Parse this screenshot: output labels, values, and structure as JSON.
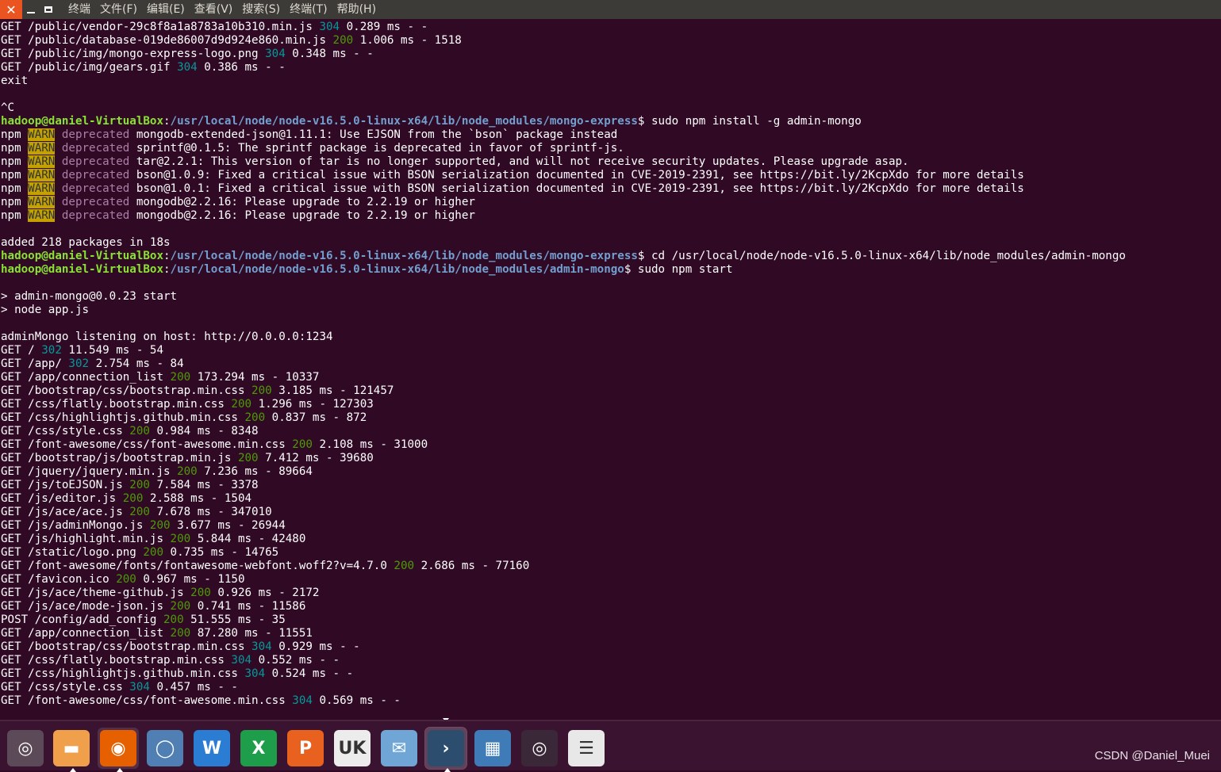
{
  "window": {
    "menus": [
      "终端",
      "文件(F)",
      "编辑(E)",
      "查看(V)",
      "搜索(S)",
      "终端(T)",
      "帮助(H)"
    ]
  },
  "terminal_lines": [
    [
      {
        "t": "GET /public/vendor-29c8f8a1a8783a10b310.min.js "
      },
      {
        "t": "304",
        "c": "c-304"
      },
      {
        "t": " 0.289 ms - -"
      }
    ],
    [
      {
        "t": "GET /public/database-019de86007d9d924e860.min.js "
      },
      {
        "t": "200",
        "c": "c-200"
      },
      {
        "t": " 1.006 ms - 1518"
      }
    ],
    [
      {
        "t": "GET /public/img/mongo-express-logo.png "
      },
      {
        "t": "304",
        "c": "c-304"
      },
      {
        "t": " 0.348 ms - -"
      }
    ],
    [
      {
        "t": "GET /public/img/gears.gif "
      },
      {
        "t": "304",
        "c": "c-304"
      },
      {
        "t": " 0.386 ms - -"
      }
    ],
    [
      {
        "t": "exit"
      }
    ],
    [
      {
        "t": ""
      }
    ],
    [
      {
        "t": "^C"
      }
    ],
    [
      {
        "t": "hadoop@daniel-VirtualBox",
        "c": "prompt-user"
      },
      {
        "t": ":"
      },
      {
        "t": "/usr/local/node/node-v16.5.0-linux-x64/lib/node_modules/mongo-express",
        "c": "prompt-path"
      },
      {
        "t": "$ sudo npm install -g admin-mongo"
      }
    ],
    [
      {
        "t": "npm "
      },
      {
        "t": "WARN",
        "c": "warn"
      },
      {
        "t": " "
      },
      {
        "t": "deprecated",
        "c": "dep"
      },
      {
        "t": " mongodb-extended-json@1.11.1: Use EJSON from the `bson` package instead"
      }
    ],
    [
      {
        "t": "npm "
      },
      {
        "t": "WARN",
        "c": "warn"
      },
      {
        "t": " "
      },
      {
        "t": "deprecated",
        "c": "dep"
      },
      {
        "t": " sprintf@0.1.5: The sprintf package is deprecated in favor of sprintf-js."
      }
    ],
    [
      {
        "t": "npm "
      },
      {
        "t": "WARN",
        "c": "warn"
      },
      {
        "t": " "
      },
      {
        "t": "deprecated",
        "c": "dep"
      },
      {
        "t": " tar@2.2.1: This version of tar is no longer supported, and will not receive security updates. Please upgrade asap."
      }
    ],
    [
      {
        "t": "npm "
      },
      {
        "t": "WARN",
        "c": "warn"
      },
      {
        "t": " "
      },
      {
        "t": "deprecated",
        "c": "dep"
      },
      {
        "t": " bson@1.0.9: Fixed a critical issue with BSON serialization documented in CVE-2019-2391, see https://bit.ly/2KcpXdo for more details"
      }
    ],
    [
      {
        "t": "npm "
      },
      {
        "t": "WARN",
        "c": "warn"
      },
      {
        "t": " "
      },
      {
        "t": "deprecated",
        "c": "dep"
      },
      {
        "t": " bson@1.0.1: Fixed a critical issue with BSON serialization documented in CVE-2019-2391, see https://bit.ly/2KcpXdo for more details"
      }
    ],
    [
      {
        "t": "npm "
      },
      {
        "t": "WARN",
        "c": "warn"
      },
      {
        "t": " "
      },
      {
        "t": "deprecated",
        "c": "dep"
      },
      {
        "t": " mongodb@2.2.16: Please upgrade to 2.2.19 or higher"
      }
    ],
    [
      {
        "t": "npm "
      },
      {
        "t": "WARN",
        "c": "warn"
      },
      {
        "t": " "
      },
      {
        "t": "deprecated",
        "c": "dep"
      },
      {
        "t": " mongodb@2.2.16: Please upgrade to 2.2.19 or higher"
      }
    ],
    [
      {
        "t": ""
      }
    ],
    [
      {
        "t": "added 218 packages in 18s"
      }
    ],
    [
      {
        "t": "hadoop@daniel-VirtualBox",
        "c": "prompt-user"
      },
      {
        "t": ":"
      },
      {
        "t": "/usr/local/node/node-v16.5.0-linux-x64/lib/node_modules/mongo-express",
        "c": "prompt-path"
      },
      {
        "t": "$ cd /usr/local/node/node-v16.5.0-linux-x64/lib/node_modules/admin-mongo"
      }
    ],
    [
      {
        "t": "hadoop@daniel-VirtualBox",
        "c": "prompt-user"
      },
      {
        "t": ":"
      },
      {
        "t": "/usr/local/node/node-v16.5.0-linux-x64/lib/node_modules/admin-mongo",
        "c": "prompt-path"
      },
      {
        "t": "$ sudo npm start"
      }
    ],
    [
      {
        "t": ""
      }
    ],
    [
      {
        "t": "> admin-mongo@0.0.23 start"
      }
    ],
    [
      {
        "t": "> node app.js"
      }
    ],
    [
      {
        "t": ""
      }
    ],
    [
      {
        "t": "adminMongo listening on host: http://0.0.0.0:1234"
      }
    ],
    [
      {
        "t": "GET / "
      },
      {
        "t": "302",
        "c": "c-302"
      },
      {
        "t": " 11.549 ms - 54"
      }
    ],
    [
      {
        "t": "GET /app/ "
      },
      {
        "t": "302",
        "c": "c-302"
      },
      {
        "t": " 2.754 ms - 84"
      }
    ],
    [
      {
        "t": "GET /app/connection_list "
      },
      {
        "t": "200",
        "c": "c-200"
      },
      {
        "t": " 173.294 ms - 10337"
      }
    ],
    [
      {
        "t": "GET /bootstrap/css/bootstrap.min.css "
      },
      {
        "t": "200",
        "c": "c-200"
      },
      {
        "t": " 3.185 ms - 121457"
      }
    ],
    [
      {
        "t": "GET /css/flatly.bootstrap.min.css "
      },
      {
        "t": "200",
        "c": "c-200"
      },
      {
        "t": " 1.296 ms - 127303"
      }
    ],
    [
      {
        "t": "GET /css/highlightjs.github.min.css "
      },
      {
        "t": "200",
        "c": "c-200"
      },
      {
        "t": " 0.837 ms - 872"
      }
    ],
    [
      {
        "t": "GET /css/style.css "
      },
      {
        "t": "200",
        "c": "c-200"
      },
      {
        "t": " 0.984 ms - 8348"
      }
    ],
    [
      {
        "t": "GET /font-awesome/css/font-awesome.min.css "
      },
      {
        "t": "200",
        "c": "c-200"
      },
      {
        "t": " 2.108 ms - 31000"
      }
    ],
    [
      {
        "t": "GET /bootstrap/js/bootstrap.min.js "
      },
      {
        "t": "200",
        "c": "c-200"
      },
      {
        "t": " 7.412 ms - 39680"
      }
    ],
    [
      {
        "t": "GET /jquery/jquery.min.js "
      },
      {
        "t": "200",
        "c": "c-200"
      },
      {
        "t": " 7.236 ms - 89664"
      }
    ],
    [
      {
        "t": "GET /js/toEJSON.js "
      },
      {
        "t": "200",
        "c": "c-200"
      },
      {
        "t": " 7.584 ms - 3378"
      }
    ],
    [
      {
        "t": "GET /js/editor.js "
      },
      {
        "t": "200",
        "c": "c-200"
      },
      {
        "t": " 2.588 ms - 1504"
      }
    ],
    [
      {
        "t": "GET /js/ace/ace.js "
      },
      {
        "t": "200",
        "c": "c-200"
      },
      {
        "t": " 7.678 ms - 347010"
      }
    ],
    [
      {
        "t": "GET /js/adminMongo.js "
      },
      {
        "t": "200",
        "c": "c-200"
      },
      {
        "t": " 3.677 ms - 26944"
      }
    ],
    [
      {
        "t": "GET /js/highlight.min.js "
      },
      {
        "t": "200",
        "c": "c-200"
      },
      {
        "t": " 5.844 ms - 42480"
      }
    ],
    [
      {
        "t": "GET /static/logo.png "
      },
      {
        "t": "200",
        "c": "c-200"
      },
      {
        "t": " 0.735 ms - 14765"
      }
    ],
    [
      {
        "t": "GET /font-awesome/fonts/fontawesome-webfont.woff2?v=4.7.0 "
      },
      {
        "t": "200",
        "c": "c-200"
      },
      {
        "t": " 2.686 ms - 77160"
      }
    ],
    [
      {
        "t": "GET /favicon.ico "
      },
      {
        "t": "200",
        "c": "c-200"
      },
      {
        "t": " 0.967 ms - 1150"
      }
    ],
    [
      {
        "t": "GET /js/ace/theme-github.js "
      },
      {
        "t": "200",
        "c": "c-200"
      },
      {
        "t": " 0.926 ms - 2172"
      }
    ],
    [
      {
        "t": "GET /js/ace/mode-json.js "
      },
      {
        "t": "200",
        "c": "c-200"
      },
      {
        "t": " 0.741 ms - 11586"
      }
    ],
    [
      {
        "t": "POST /config/add_config "
      },
      {
        "t": "200",
        "c": "c-200"
      },
      {
        "t": " 51.555 ms - 35"
      }
    ],
    [
      {
        "t": "GET /app/connection_list "
      },
      {
        "t": "200",
        "c": "c-200"
      },
      {
        "t": " 87.280 ms - 11551"
      }
    ],
    [
      {
        "t": "GET /bootstrap/css/bootstrap.min.css "
      },
      {
        "t": "304",
        "c": "c-304"
      },
      {
        "t": " 0.929 ms - -"
      }
    ],
    [
      {
        "t": "GET /css/flatly.bootstrap.min.css "
      },
      {
        "t": "304",
        "c": "c-304"
      },
      {
        "t": " 0.552 ms - -"
      }
    ],
    [
      {
        "t": "GET /css/highlightjs.github.min.css "
      },
      {
        "t": "304",
        "c": "c-304"
      },
      {
        "t": " 0.524 ms - -"
      }
    ],
    [
      {
        "t": "GET /css/style.css "
      },
      {
        "t": "304",
        "c": "c-304"
      },
      {
        "t": " 0.457 ms - -"
      }
    ],
    [
      {
        "t": "GET /font-awesome/css/font-awesome.min.css "
      },
      {
        "t": "304",
        "c": "c-304"
      },
      {
        "t": " 0.569 ms - -"
      }
    ]
  ],
  "dock": {
    "items": [
      {
        "name": "ubuntu-logo-icon",
        "bg": "#5c4a58",
        "glyph": "◎",
        "active": false,
        "running": false
      },
      {
        "name": "files-icon",
        "bg": "#f0a04b",
        "glyph": "▬",
        "active": false,
        "running": true
      },
      {
        "name": "firefox-icon",
        "bg": "#e66000",
        "glyph": "◉",
        "active": true,
        "running": true
      },
      {
        "name": "chromium-icon",
        "bg": "#4f7fb3",
        "glyph": "◯",
        "active": false,
        "running": false
      },
      {
        "name": "wps-writer-icon",
        "bg": "#2b7cd3",
        "glyph": "W",
        "active": false,
        "running": false
      },
      {
        "name": "wps-spreadsheet-icon",
        "bg": "#1e9e4a",
        "glyph": "X",
        "active": false,
        "running": false
      },
      {
        "name": "wps-presentation-icon",
        "bg": "#e8611f",
        "glyph": "P",
        "active": false,
        "running": false
      },
      {
        "name": "ubuntu-software-icon",
        "bg": "#ececec",
        "glyph": "UK",
        "active": false,
        "running": false
      },
      {
        "name": "mail-client-icon",
        "bg": "#6fa6d6",
        "glyph": "✉",
        "active": false,
        "running": false
      },
      {
        "name": "terminal-icon",
        "bg": "#2c4d6e",
        "glyph": "›",
        "active": false,
        "running": true,
        "focused": true
      },
      {
        "name": "workspace-switcher-icon",
        "bg": "#3e7bb7",
        "glyph": "▦",
        "active": false,
        "running": false
      },
      {
        "name": "disc-burner-icon",
        "bg": "#3a2838",
        "glyph": "◎",
        "active": false,
        "running": false
      },
      {
        "name": "disk-drive-icon",
        "bg": "#e8e8e8",
        "glyph": "☰",
        "active": false,
        "running": false
      }
    ]
  },
  "watermark": "CSDN @Daniel_Muei"
}
